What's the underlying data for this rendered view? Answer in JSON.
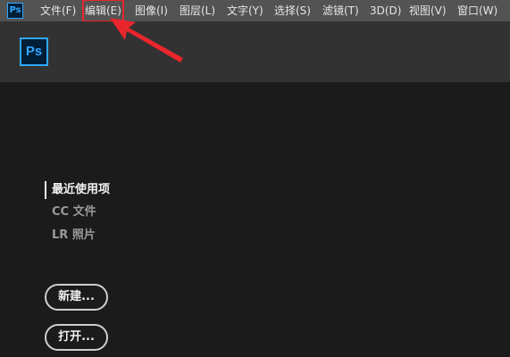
{
  "app": {
    "icon_label": "Ps",
    "logo_label": "Ps"
  },
  "menubar": {
    "items": [
      {
        "label": "文件(F)"
      },
      {
        "label": "编辑(E)",
        "highlighted": true
      },
      {
        "label": "图像(I)"
      },
      {
        "label": "图层(L)"
      },
      {
        "label": "文字(Y)"
      },
      {
        "label": "选择(S)"
      },
      {
        "label": "滤镜(T)"
      },
      {
        "label": "3D(D)"
      },
      {
        "label": "视图(V)"
      },
      {
        "label": "窗口(W)"
      }
    ]
  },
  "start": {
    "nav": [
      {
        "label": "最近使用项",
        "active": true
      },
      {
        "label": "CC 文件",
        "active": false
      },
      {
        "label": "LR 照片",
        "active": false
      }
    ],
    "new_label": "新建...",
    "open_label": "打开..."
  },
  "colors": {
    "menubar_bg": "#535353",
    "header_bg": "#323232",
    "workspace_bg": "#1b1b1b",
    "ps_blue": "#31a8ff",
    "annotation_red": "#e8262c"
  }
}
